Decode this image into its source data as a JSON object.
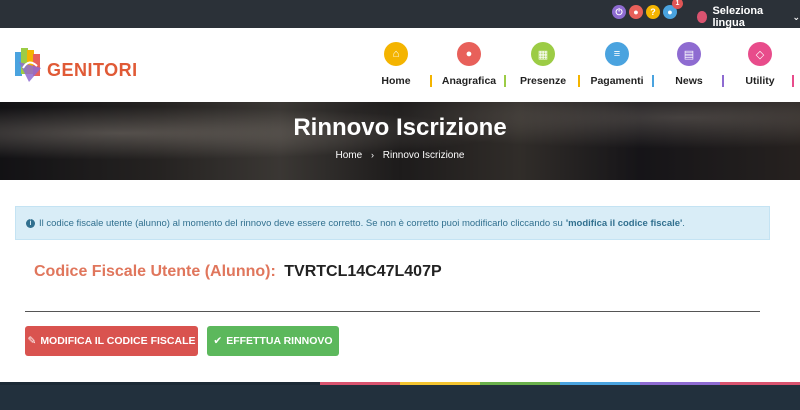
{
  "topbar": {
    "notification_count": "1",
    "language_label": "Seleziona lingua",
    "icons": [
      "power-icon",
      "user-icon",
      "help-icon",
      "user-alert-icon"
    ]
  },
  "logo": {
    "text": "GENITORI"
  },
  "nav": [
    {
      "label": "Home",
      "icon": "home-icon",
      "color": "#f4b400"
    },
    {
      "label": "Anagrafica",
      "icon": "user-icon",
      "color": "#e8605a"
    },
    {
      "label": "Presenze",
      "icon": "calendar-icon",
      "color": "#9ccc45"
    },
    {
      "label": "Pagamenti",
      "icon": "list-icon",
      "color": "#4aa3df"
    },
    {
      "label": "News",
      "icon": "news-icon",
      "color": "#8e6bd1"
    },
    {
      "label": "Utility",
      "icon": "link-icon",
      "color": "#e84c8b"
    }
  ],
  "hero": {
    "title": "Rinnovo Iscrizione",
    "breadcrumb_home": "Home",
    "breadcrumb_current": "Rinnovo Iscrizione"
  },
  "alert": {
    "text": "Il codice fiscale utente (alunno) al momento del rinnovo deve essere corretto. Se non è corretto puoi modificarlo cliccando su",
    "link_text": "'modifica il codice fiscale'",
    "suffix": "."
  },
  "codice_fiscale": {
    "label": "Codice Fiscale Utente (Alunno):",
    "value": "TVRTCL14C47L407P"
  },
  "buttons": {
    "edit_label": "MODIFICA IL CODICE FISCALE",
    "renew_label": "EFFETTUA RINNOVO"
  }
}
